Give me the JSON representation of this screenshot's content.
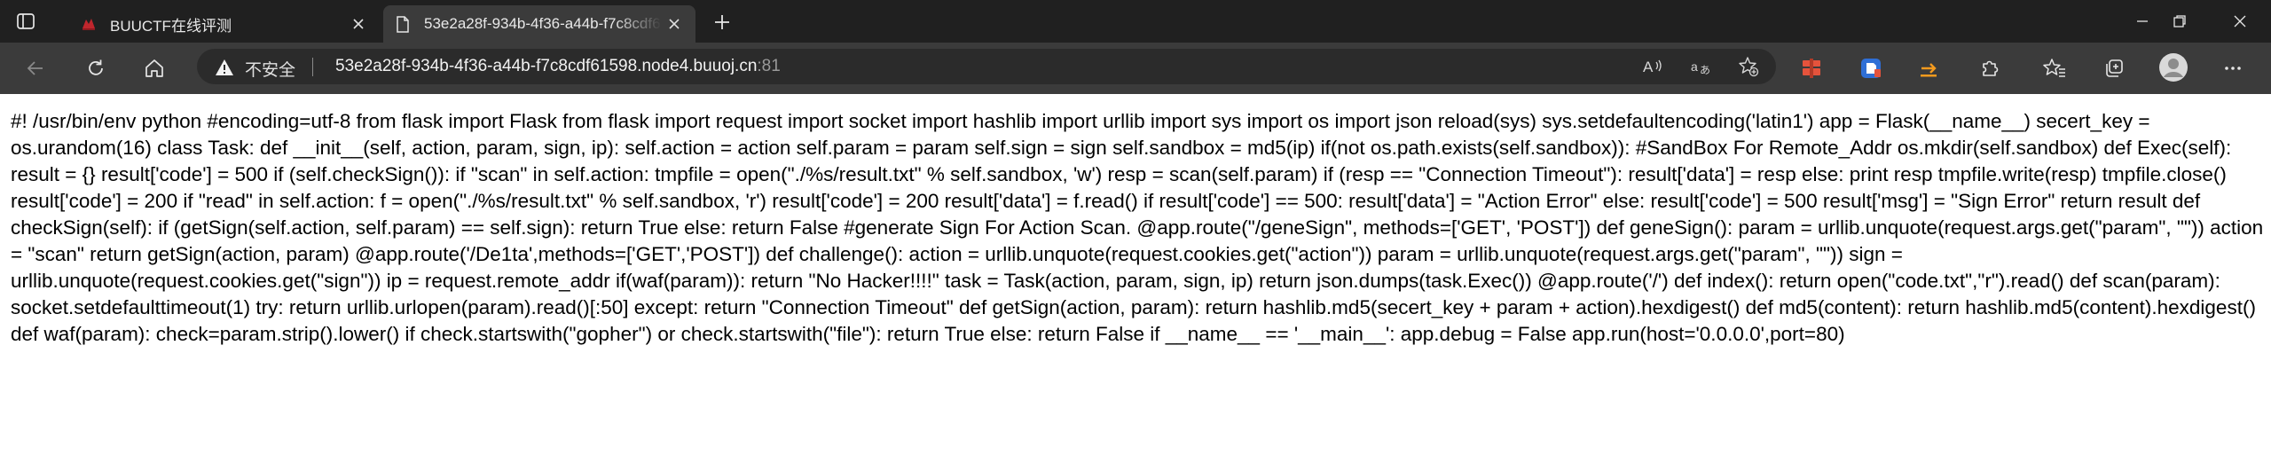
{
  "browser": {
    "tabs": [
      {
        "title": "BUUCTF在线评测",
        "active": false,
        "favicon": "buuctf-logo-icon",
        "favicon_color": "#c0262d"
      },
      {
        "title": "53e2a28f-934b-4f36-a44b-f7c8cdf61598.node4.buuoj.cn:81",
        "active": true,
        "favicon": "page-icon"
      }
    ],
    "address": {
      "security_label": "不安全",
      "host": "53e2a28f-934b-4f36-a44b-f7c8cdf61598.node4.buuoj.cn",
      "port": ":81"
    },
    "colors": {
      "tabstrip": "#202020",
      "toolbar": "#3b3b3b",
      "extension_red": "#e5533c",
      "extension_blue": "#2f6fd6",
      "extension_orange": "#f39a1e"
    }
  },
  "page": {
    "source_text": "#! /usr/bin/env python #encoding=utf-8 from flask import Flask from flask import request import socket import hashlib import urllib import sys import os import json reload(sys) sys.setdefaultencoding('latin1') app = Flask(__name__) secert_key = os.urandom(16) class Task: def __init__(self, action, param, sign, ip): self.action = action self.param = param self.sign = sign self.sandbox = md5(ip) if(not os.path.exists(self.sandbox)): #SandBox For Remote_Addr os.mkdir(self.sandbox) def Exec(self): result = {} result['code'] = 500 if (self.checkSign()): if \"scan\" in self.action: tmpfile = open(\"./%s/result.txt\" % self.sandbox, 'w') resp = scan(self.param) if (resp == \"Connection Timeout\"): result['data'] = resp else: print resp tmpfile.write(resp) tmpfile.close() result['code'] = 200 if \"read\" in self.action: f = open(\"./%s/result.txt\" % self.sandbox, 'r') result['code'] = 200 result['data'] = f.read() if result['code'] == 500: result['data'] = \"Action Error\" else: result['code'] = 500 result['msg'] = \"Sign Error\" return result def checkSign(self): if (getSign(self.action, self.param) == self.sign): return True else: return False #generate Sign For Action Scan. @app.route(\"/geneSign\", methods=['GET', 'POST']) def geneSign(): param = urllib.unquote(request.args.get(\"param\", \"\")) action = \"scan\" return getSign(action, param) @app.route('/De1ta',methods=['GET','POST']) def challenge(): action = urllib.unquote(request.cookies.get(\"action\")) param = urllib.unquote(request.args.get(\"param\", \"\")) sign = urllib.unquote(request.cookies.get(\"sign\")) ip = request.remote_addr if(waf(param)): return \"No Hacker!!!!\" task = Task(action, param, sign, ip) return json.dumps(task.Exec()) @app.route('/') def index(): return open(\"code.txt\",\"r\").read() def scan(param): socket.setdefaulttimeout(1) try: return urllib.urlopen(param).read()[:50] except: return \"Connection Timeout\" def getSign(action, param): return hashlib.md5(secert_key + param + action).hexdigest() def md5(content): return hashlib.md5(content).hexdigest() def waf(param): check=param.strip().lower() if check.startswith(\"gopher\") or check.startswith(\"file\"): return True else: return False if __name__ == '__main__': app.debug = False app.run(host='0.0.0.0',port=80)"
  }
}
